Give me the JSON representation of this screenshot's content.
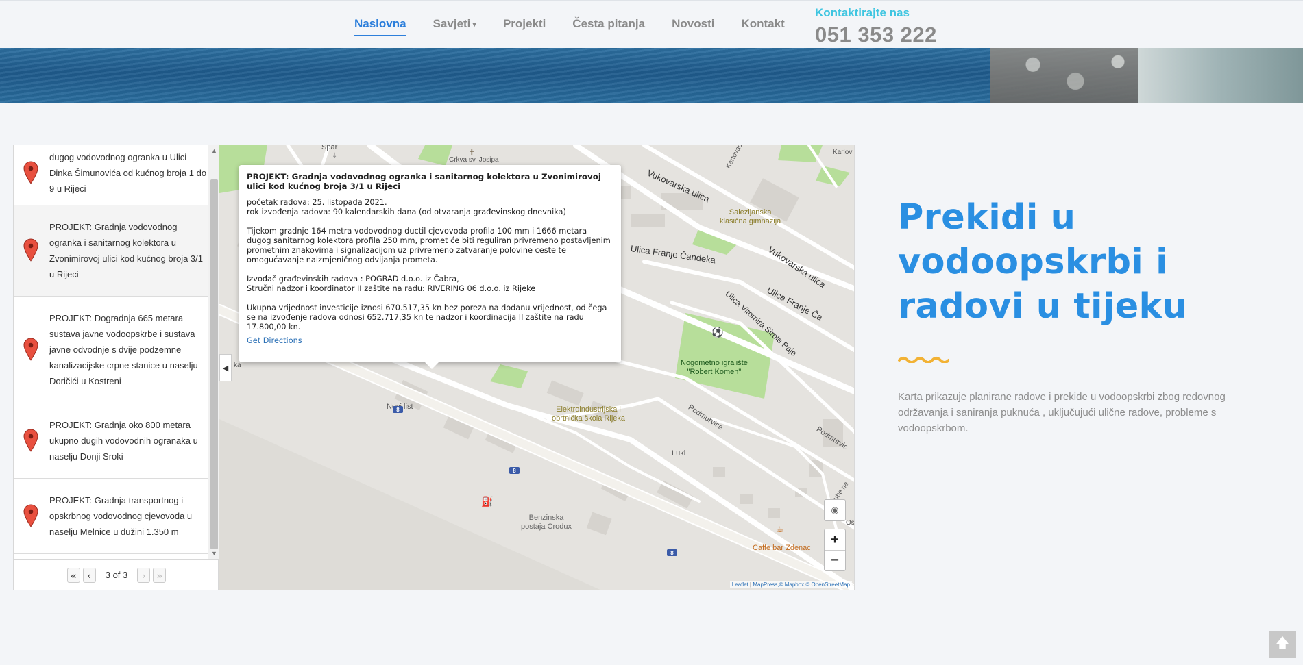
{
  "nav": {
    "items": [
      {
        "label": "Naslovna",
        "active": true
      },
      {
        "label": "Savjeti",
        "dropdown": true
      },
      {
        "label": "Projekti"
      },
      {
        "label": "Česta pitanja"
      },
      {
        "label": "Novosti"
      },
      {
        "label": "Kontakt"
      }
    ],
    "contact_label": "Kontaktirajte nas",
    "contact_phone": "051 353 222"
  },
  "list": {
    "items": [
      {
        "text": "dugog vodovodnog ogranka u Ulici Dinka Šimunovića od kućnog broja 1 do 9 u Rijeci"
      },
      {
        "text": "PROJEKT: Gradnja vodovodnog ogranka i sanitarnog kolektora u Zvonimirovoj ulici kod kućnog broja 3/1 u Rijeci",
        "selected": true
      },
      {
        "text": "PROJEKT: Dogradnja 665 metara sustava javne vodoopskrbe i sustava javne odvodnje s dvije podzemne kanalizacijske crpne stanice u naselju Doričići u Kostreni"
      },
      {
        "text": "PROJEKT: Gradnja oko 800 metara ukupno dugih vodovodnih ogranaka u naselju Donji Sroki"
      },
      {
        "text": "PROJEKT: Gradnja transportnog i opskrbnog vodovodnog cjevovoda u naselju Melnice u dužini 1.350 m"
      }
    ],
    "pager": {
      "first": "«",
      "prev": "‹",
      "info": "3 of 3",
      "next": "›",
      "last": "»"
    }
  },
  "popup": {
    "title": "PROJEKT: Gradnja vodovodnog ogranka i sanitarnog kolektora u Zvonimirovoj ulici kod kućnog broja 3/1 u Rijeci",
    "start": "početak radova: 25. listopada 2021.",
    "duration": "rok izvođenja radova: 90 kalendarskih dana (od otvaranja građevinskog dnevnika)",
    "body": "Tijekom gradnje 164 metra vodovodnog ductil cjevovoda profila 100 mm i 1666 metara dugog sanitarnog kolektora profila 250 mm, promet će biti reguliran privremeno postavljenim prometnim znakovima i signalizacijom uz privremeno zatvaranje polovine ceste te omogućavanje naizmjeničnog odvijanja prometa.",
    "contractor": "Izvođač građevinskih radova : POGRAD d.o.o. iz Čabra,",
    "supervision": "Stručni nadzor i koordinator II zaštite na radu: RIVERING 06 d.o.o. iz Rijeke",
    "value": "Ukupna vrijednost investicije iznosi 670.517,35 kn bez poreza na dodanu vrijednost, od čega se na izvođenje radova odnosi 652.717,35 kn te nadzor i koordinacija II zaštite na radu 17.800,00 kn.",
    "directions": "Get Directions"
  },
  "map": {
    "labels": {
      "spar": "Spar",
      "crkva": "Crkva sv. Josipa",
      "vukovarska1": "Vukovarska ulica",
      "vukovarska2": "Vukovarska ulica",
      "kartova": "Kartovačka",
      "karlov": "Karlov",
      "gimnazija": "Salezijanska\nklasična gimnazija",
      "candek1": "Ulica Franje Čandeka",
      "candek2": "Ulica Franje Ča",
      "vitomir": "Ulica Vitomira Širole Paje",
      "igraliste": "Nogometno igralište\n\"Robert Komen\"",
      "novilist": "Novi list",
      "elektro": "Elektroindustrijska i\nobrtnička škola Rijeka",
      "podmurvice1": "Podmurvice",
      "podmurvice2": "Podmurvic",
      "luki": "Luki",
      "benzinska": "Benzinska\npostaja Crodux",
      "caffe": "Caffe bar Zdenac",
      "stube": "Stube na",
      "osnov": "Osno",
      "ka": "ka"
    },
    "shields": [
      "8",
      "8",
      "8"
    ],
    "zoom_in": "+",
    "zoom_out": "−",
    "attribution_leaflet": "Leaflet",
    "attribution_rest": "MapPress,© Mapbox,© OpenStreetMap"
  },
  "hero_text": {
    "heading": "Prekidi u vodoopskrbi i radovi u tijeku",
    "description": "Karta prikazuje planirane radove i prekide u vodoopskrbi zbog redovnog održavanja i saniranja puknuća , uključujući ulične radove, probleme s vodoopskrbom."
  },
  "colors": {
    "accent": "#2a8fe2",
    "contact": "#3ec5e0",
    "squiggle": "#f2b235"
  },
  "icons": {
    "pin": "map-marker-icon",
    "to_top": "arrow-up-icon"
  }
}
